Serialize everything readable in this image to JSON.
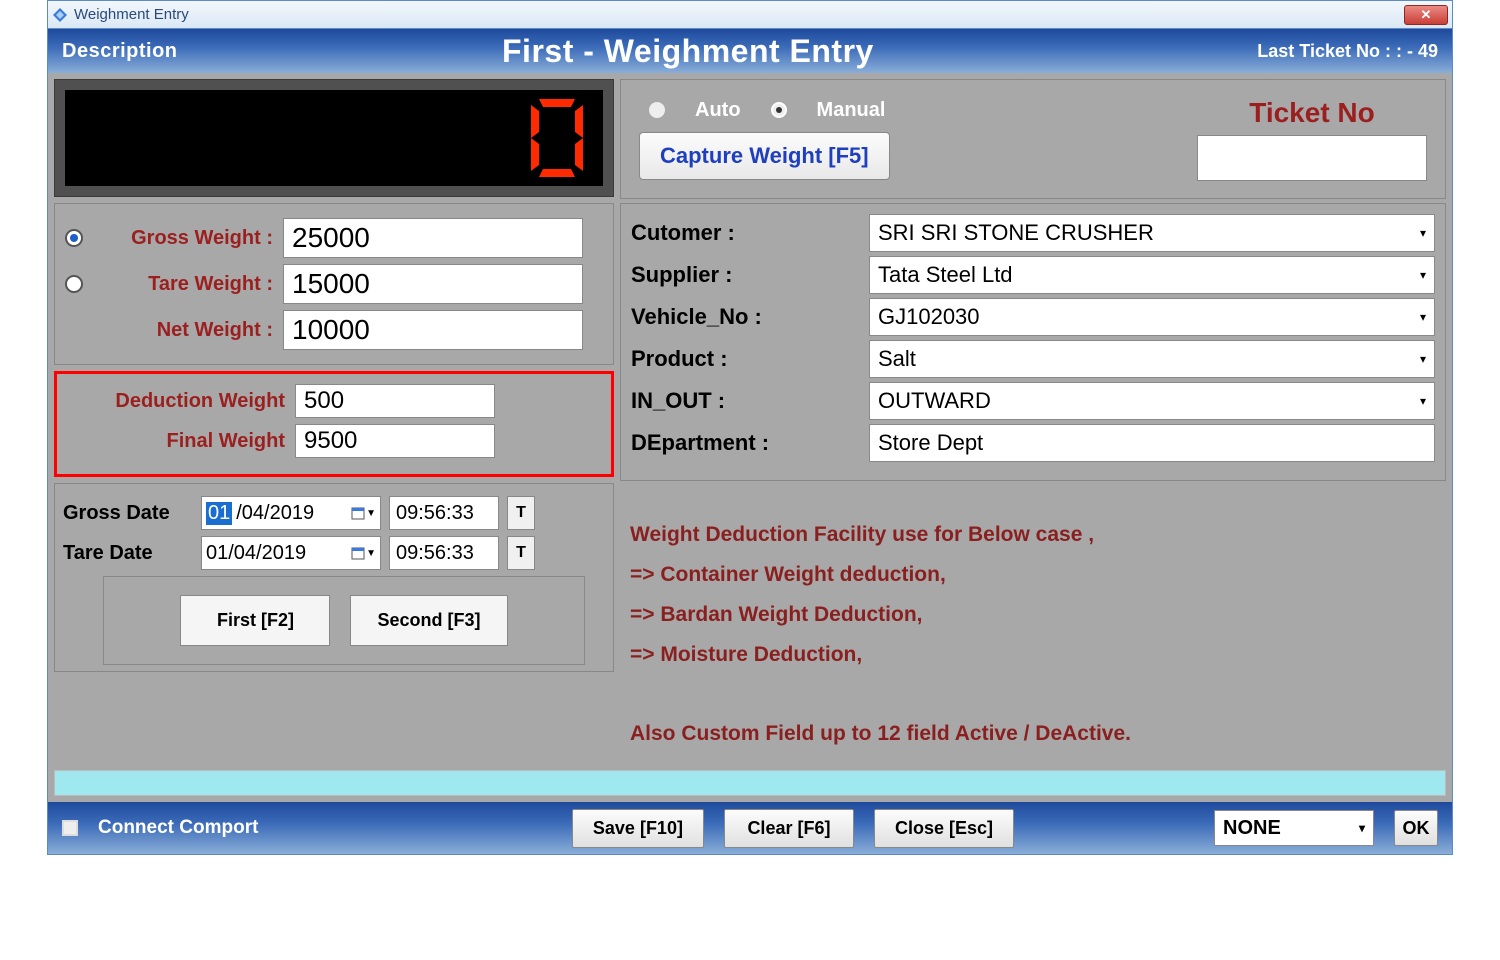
{
  "window": {
    "title": "Weighment Entry"
  },
  "header": {
    "description": "Description",
    "title": "First - Weighment Entry",
    "last_ticket": "Last Ticket No :   : - 49"
  },
  "lcd": {
    "value": "0"
  },
  "weights": {
    "gross_label": "Gross Weight :",
    "gross_value": "25000",
    "tare_label": "Tare Weight  :",
    "tare_value": "15000",
    "net_label": "Net Weight :",
    "net_value": "10000"
  },
  "deduction": {
    "ded_label": "Deduction Weight",
    "ded_value": "500",
    "final_label": "Final Weight",
    "final_value": "9500"
  },
  "dates": {
    "gross_label": "Gross Date",
    "tare_label": "Tare Date",
    "day_sel": "01",
    "date_rest": "/04/2019",
    "date2": "01/04/2019",
    "time": "09:56:33",
    "t": "T"
  },
  "buttons": {
    "first": "First [F2]",
    "second": "Second [F3]"
  },
  "mode": {
    "auto": "Auto",
    "manual": "Manual",
    "capture": "Capture Weight [F5]",
    "ticket_label": "Ticket No"
  },
  "details": {
    "customer_label": "Cutomer :",
    "customer_value": "SRI SRI STONE CRUSHER",
    "supplier_label": "Supplier :",
    "supplier_value": "Tata Steel Ltd",
    "vehicle_label": "Vehicle_No :",
    "vehicle_value": "GJ102030",
    "product_label": "Product :",
    "product_value": "Salt",
    "inout_label": "IN_OUT :",
    "inout_value": "OUTWARD",
    "dept_label": "DEpartment :",
    "dept_value": "Store Dept"
  },
  "notes": {
    "l1": "Weight Deduction Facility use for Below case ,",
    "l2": "=> Container Weight deduction,",
    "l3": "=> Bardan Weight Deduction,",
    "l4": "=> Moisture Deduction,",
    "l5": "Also Custom Field up to 12 field Active / DeActive."
  },
  "footer": {
    "connect": "Connect Comport",
    "save": "Save [F10]",
    "clear": "Clear [F6]",
    "close": "Close [Esc]",
    "select": "NONE",
    "ok": "OK"
  }
}
